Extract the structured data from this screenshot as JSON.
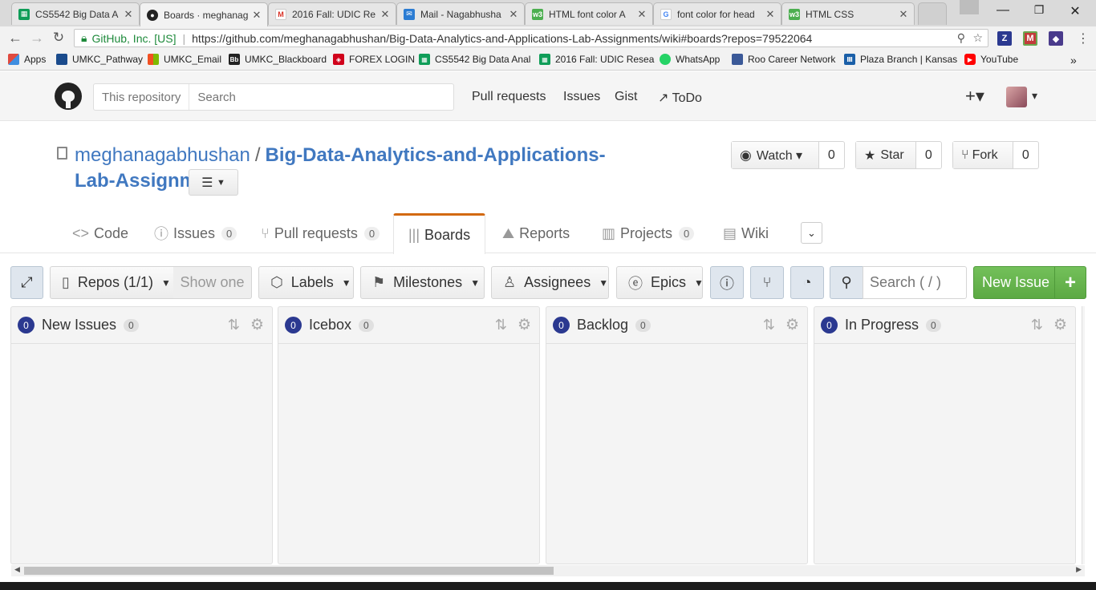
{
  "browser": {
    "tabs": [
      {
        "label": "CS5542 Big Data A",
        "icon": "sheets-icon",
        "color": "#0f9d58"
      },
      {
        "label": "Boards · meghanag",
        "icon": "github-icon",
        "color": "#222222"
      },
      {
        "label": "2016 Fall: UDIC Re",
        "icon": "gmail-icon",
        "color": "#d93025"
      },
      {
        "label": "Mail - Nagabhusha",
        "icon": "mail-icon",
        "color": "#2b7cd3"
      },
      {
        "label": "HTML font color A",
        "icon": "w3-icon",
        "color": "#4caf50"
      },
      {
        "label": "font color for head",
        "icon": "google-icon",
        "color": "#4285f4"
      },
      {
        "label": "HTML CSS",
        "icon": "w3-icon",
        "color": "#4caf50"
      }
    ],
    "url_owner": "GitHub, Inc. [US]",
    "url": "https://github.com/meghanagabhushan/Big-Data-Analytics-and-Applications-Lab-Assignments/wiki#boards?repos=79522064",
    "bookmarks": [
      {
        "label": "Apps",
        "color": "#e04a3f"
      },
      {
        "label": "UMKC_Pathway",
        "color": "#1a4b8c"
      },
      {
        "label": "UMKC_Email",
        "color": "#f25022"
      },
      {
        "label": "UMKC_Blackboard",
        "color": "#222222"
      },
      {
        "label": "FOREX LOGIN",
        "color": "#d0021b"
      },
      {
        "label": "CS5542 Big Data Anal",
        "color": "#0f9d58"
      },
      {
        "label": "2016 Fall: UDIC Resea",
        "color": "#0f9d58"
      },
      {
        "label": "WhatsApp",
        "color": "#25d366"
      },
      {
        "label": "Roo Career Network",
        "color": "#3b5998"
      },
      {
        "label": "Plaza Branch | Kansas",
        "color": "#1a5fa8"
      },
      {
        "label": "YouTube",
        "color": "#ff0000"
      }
    ]
  },
  "github": {
    "search_scope": "This repository",
    "search_placeholder": "Search",
    "nav": [
      "Pull requests",
      "Issues",
      "Gist",
      "ToDo"
    ],
    "plus": "+▾",
    "avatar_caret": "▾"
  },
  "repo": {
    "owner": "meghanagabhushan",
    "slash": "/",
    "name": "Big-Data-Analytics-and-Applications-Lab-Assignments",
    "watch_label": "Watch ▾",
    "watch_count": "0",
    "star_label": "Star",
    "star_count": "0",
    "fork_label": "Fork",
    "fork_count": "0"
  },
  "tabs": {
    "code": "Code",
    "issues": "Issues",
    "issues_count": "0",
    "pulls": "Pull requests",
    "pulls_count": "0",
    "boards": "Boards",
    "reports": "Reports",
    "projects": "Projects",
    "projects_count": "0",
    "wiki": "Wiki"
  },
  "toolbar": {
    "repos": "Repos (1/1)",
    "show_one": "Show one",
    "labels": "Labels",
    "milestones": "Milestones",
    "assignees": "Assignees",
    "epics": "Epics",
    "search_placeholder": "Search ( / )",
    "new_issue": "New Issue",
    "new_issue_plus": "+"
  },
  "columns": [
    {
      "badge": "0",
      "name": "New Issues",
      "count": "0"
    },
    {
      "badge": "0",
      "name": "Icebox",
      "count": "0"
    },
    {
      "badge": "0",
      "name": "Backlog",
      "count": "0"
    },
    {
      "badge": "0",
      "name": "In Progress",
      "count": "0"
    }
  ]
}
